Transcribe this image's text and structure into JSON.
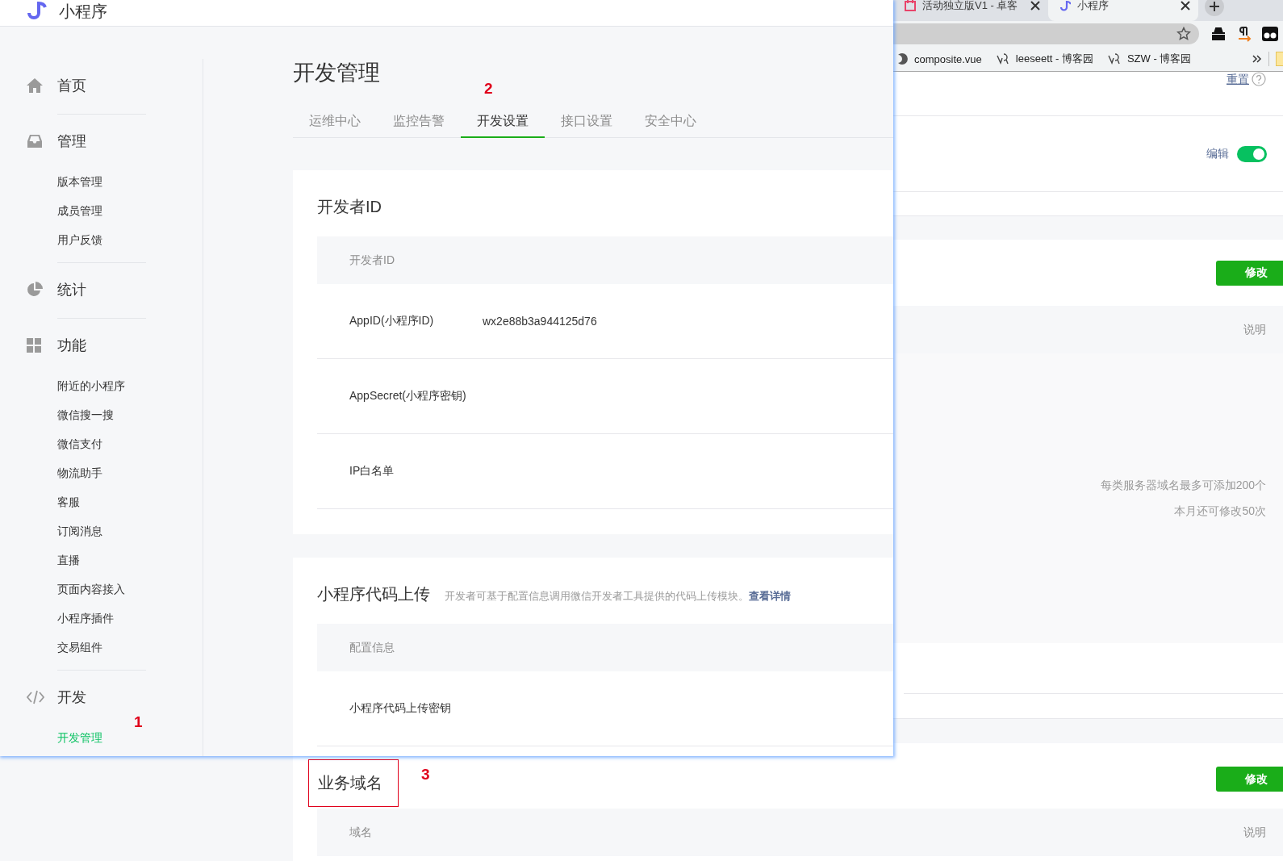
{
  "browser": {
    "tabs": [
      {
        "title": "活动独立版V1 - 卓客",
        "selected": false
      },
      {
        "title": "小程序",
        "selected": true
      }
    ],
    "bookmarks": [
      "composite.vue",
      "leeseett - 博客园",
      "SZW - 博客园"
    ]
  },
  "back_page": {
    "reset_link": "重置",
    "edit_toggle": {
      "label": "编辑",
      "on": true
    },
    "modify_button": "修改",
    "column_right": "说明",
    "limits": [
      "每类服务器域名最多可添加200个",
      "本月还可修改50次"
    ],
    "business_domain": {
      "title": "业务域名",
      "highlighted": true,
      "modify_button": "修改",
      "columns": [
        "域名",
        "说明"
      ]
    }
  },
  "app": {
    "brand": "小程序",
    "sidebar": [
      {
        "label": "首页",
        "kind": "home",
        "selected": false
      },
      {
        "label": "管理",
        "kind": "inbox",
        "selected": false,
        "children": [
          {
            "label": "版本管理",
            "selected": false
          },
          {
            "label": "成员管理",
            "selected": false
          },
          {
            "label": "用户反馈",
            "selected": false
          }
        ]
      },
      {
        "label": "统计",
        "kind": "pie",
        "selected": false
      },
      {
        "label": "功能",
        "kind": "grid",
        "selected": false,
        "children": [
          {
            "label": "附近的小程序",
            "selected": false
          },
          {
            "label": "微信搜一搜",
            "selected": false
          },
          {
            "label": "微信支付",
            "selected": false
          },
          {
            "label": "物流助手",
            "selected": false
          },
          {
            "label": "客服",
            "selected": false
          },
          {
            "label": "订阅消息",
            "selected": false
          },
          {
            "label": "直播",
            "selected": false
          },
          {
            "label": "页面内容接入",
            "selected": false
          },
          {
            "label": "小程序插件",
            "selected": false
          },
          {
            "label": "交易组件",
            "selected": false
          }
        ]
      },
      {
        "label": "开发",
        "kind": "code",
        "selected": false,
        "children": [
          {
            "label": "开发管理",
            "selected": true
          }
        ]
      }
    ],
    "page_title": "开发管理",
    "tabs": [
      {
        "label": "运维中心",
        "selected": false
      },
      {
        "label": "监控告警",
        "selected": false
      },
      {
        "label": "开发设置",
        "selected": true
      },
      {
        "label": "接口设置",
        "selected": false
      },
      {
        "label": "安全中心",
        "selected": false
      }
    ],
    "cards": [
      {
        "title": "开发者ID",
        "header": "开发者ID",
        "rows": [
          {
            "label": "AppID(小程序ID)",
            "value": "wx2e88b3a944125d76"
          },
          {
            "label": "AppSecret(小程序密钥)"
          },
          {
            "label": "IP白名单"
          }
        ]
      },
      {
        "title": "小程序代码上传",
        "description": "开发者可基于配置信息调用微信开发者工具提供的代码上传模块。",
        "link": "查看详情",
        "header": "配置信息",
        "rows": [
          {
            "label": "小程序代码上传密钥"
          }
        ]
      }
    ]
  },
  "annotations": [
    {
      "text": "1"
    },
    {
      "text": "2"
    },
    {
      "text": "3"
    }
  ]
}
